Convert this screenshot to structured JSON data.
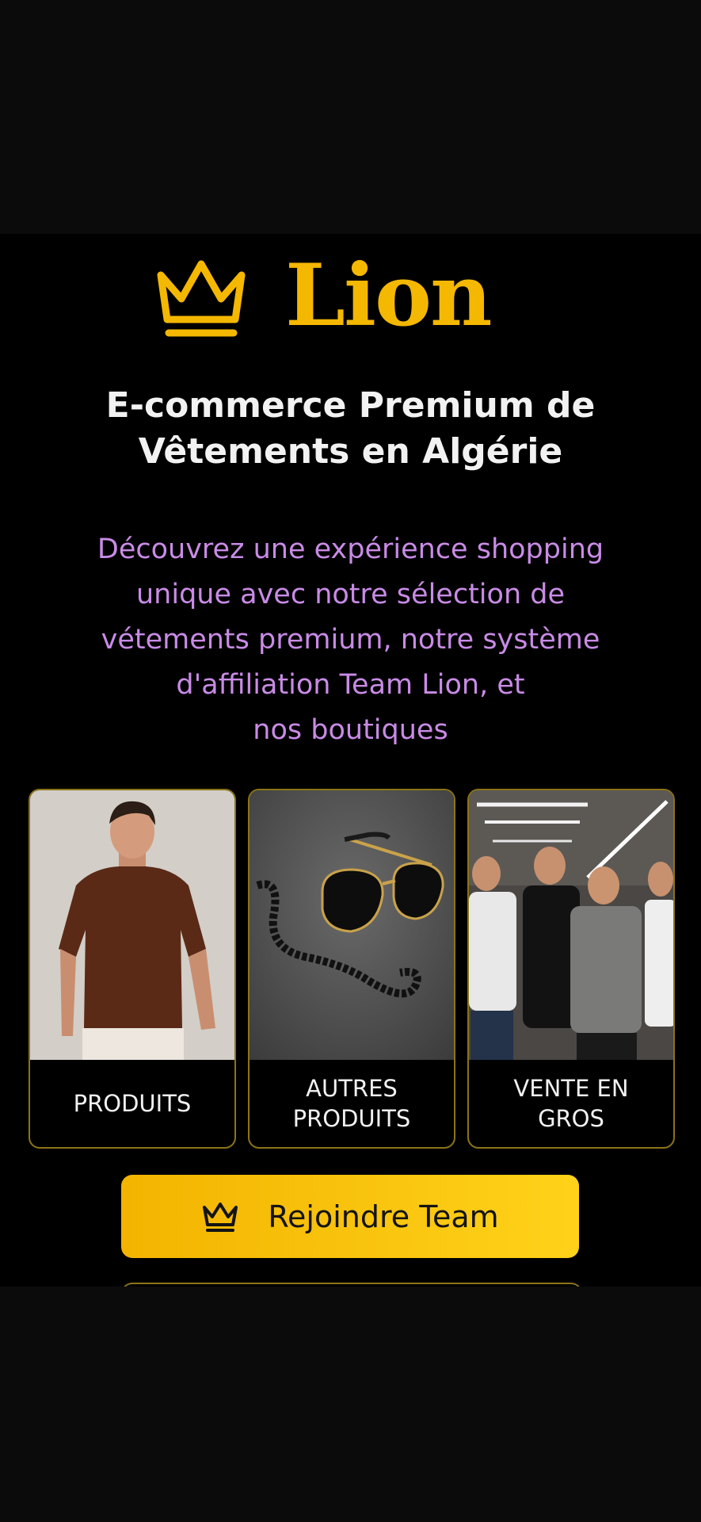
{
  "brand": {
    "name": "Lion",
    "logo_icon": "crown-icon",
    "accent_color": "#f5b800"
  },
  "hero": {
    "headline_line1": "E-commerce Premium de",
    "headline_line2": "Vêtements en Algérie",
    "tagline_lines": [
      "Découvrez une expérience shopping",
      "unique avec notre sélection de",
      "vétements premium, notre système",
      "d'affiliation Team Lion, et",
      "nos boutiques"
    ],
    "tagline_color": "#c98be6"
  },
  "cards": [
    {
      "label": "PRODUITS",
      "image": "man-brown-tshirt-photo"
    },
    {
      "label": "AUTRES\nPRODUITS",
      "image": "sunglasses-chain-photo"
    },
    {
      "label": "VENTE EN\nGROS",
      "image": "group-of-men-photo"
    }
  ],
  "cta": {
    "label": "Rejoindre Team",
    "icon": "crown-icon"
  }
}
